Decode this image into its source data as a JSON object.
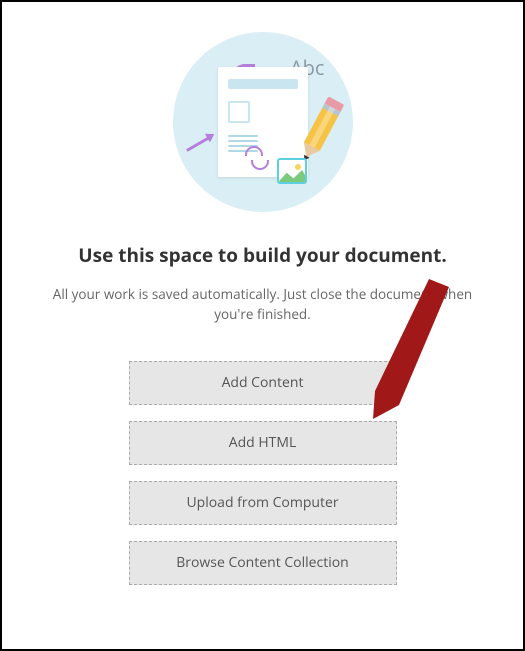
{
  "illustration": {
    "abc_label": "Abc"
  },
  "heading": "Use this space to build your document.",
  "subtext": "All your work is saved automatically. Just close the document when you're finished.",
  "buttons": {
    "add_content": "Add Content",
    "add_html": "Add HTML",
    "upload": "Upload from Computer",
    "browse": "Browse Content Collection"
  }
}
